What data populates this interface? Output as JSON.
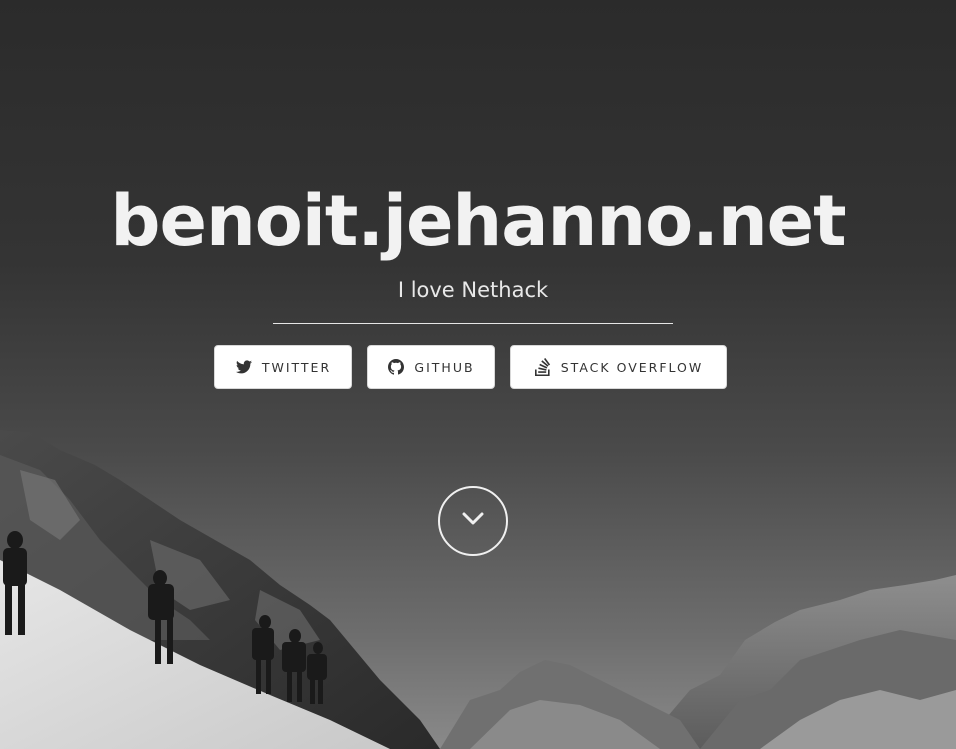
{
  "hero": {
    "title": "benoit.jehanno.net",
    "subtitle": "I love Nethack"
  },
  "social": [
    {
      "label": "TWITTER",
      "icon": "twitter-icon"
    },
    {
      "label": "GITHUB",
      "icon": "github-icon"
    },
    {
      "label": "STACK OVERFLOW",
      "icon": "stack-overflow-icon"
    }
  ],
  "scroll": {
    "icon": "chevron-down-icon"
  },
  "colors": {
    "title": "#f2f2f2",
    "button_bg": "#ffffff",
    "button_text": "#333333"
  }
}
